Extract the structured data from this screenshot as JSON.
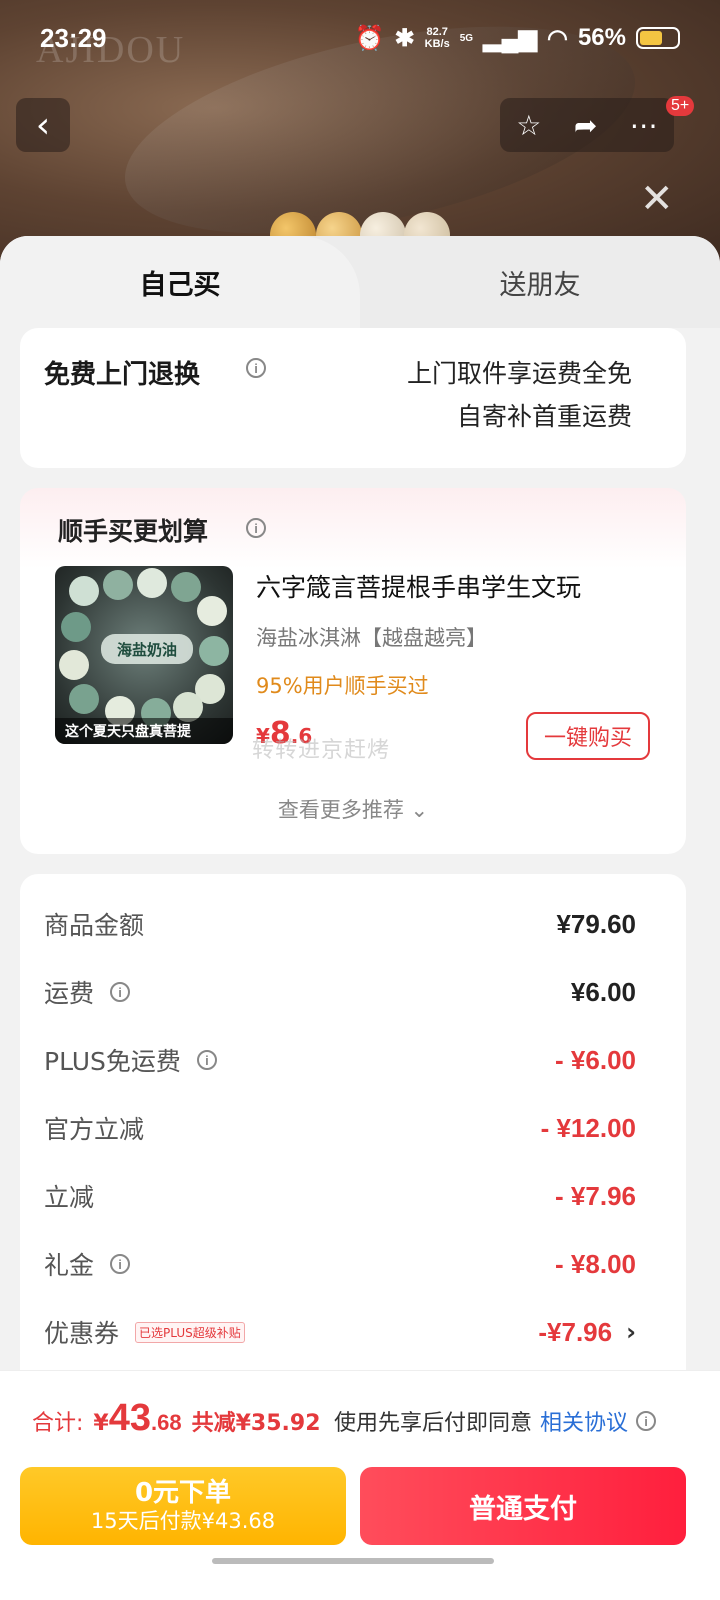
{
  "status_bar": {
    "time": "23:29",
    "net_speed": "82.7\nKB/s",
    "signal": "5G",
    "battery": "56%"
  },
  "header": {
    "back_icon": "chevron-left-icon",
    "favorite_icon": "star-icon",
    "share_icon": "share-icon",
    "more_icon": "more-icon",
    "more_badge": "5+",
    "close_icon": "close-icon",
    "brand_text": "AJIDOU"
  },
  "tabs": {
    "self_buy": "自己买",
    "gift_friend": "送朋友"
  },
  "return_service": {
    "title": "免费上门退换",
    "line1": "上门取件享运费全免",
    "line2": "自寄补首重运费"
  },
  "recommend": {
    "title": "顺手买更划算",
    "product_name": "六字箴言菩提根手串学生文玩",
    "product_sub": "海盐冰淇淋【越盘越亮】",
    "bought_rate": "95%用户顺手买过",
    "price_yen": "¥",
    "price_int": "8",
    "price_cents": ".6",
    "watermark": "转转进京赶烤",
    "buy_button": "一键购买",
    "more": "查看更多推荐",
    "thumb_center": "海盐奶油",
    "thumb_bottom": "这个夏天只盘真菩提"
  },
  "price_detail": {
    "goods_amount_label": "商品金额",
    "goods_amount": "¥79.60",
    "shipping_label": "运费",
    "shipping": "¥6.00",
    "plus_free_label": "PLUS免运费",
    "plus_free": "- ¥6.00",
    "official_label": "官方立减",
    "official": "- ¥12.00",
    "instant_label": "立减",
    "instant": "- ¥7.96",
    "gift_label": "礼金",
    "gift": "- ¥8.00",
    "coupon_label": "优惠券",
    "coupon_tag": "已选PLUS超级补贴",
    "coupon": "-¥7.96"
  },
  "bottom": {
    "total_label": "合计:",
    "total_yen": "¥",
    "total_int": "43",
    "total_cents": ".68",
    "saved": "共减¥35.92",
    "agree_text": "使用先享后付即同意",
    "agree_link": "相关协议",
    "zero_title": "0元下单",
    "zero_sub": "15天后付款¥43.68",
    "pay_button": "普通支付"
  },
  "colors": {
    "accent_red": "#e4393c",
    "bought_orange": "#e08a1b",
    "link_blue": "#2a6fd6",
    "zero_btn_yellow": "#ffb400"
  }
}
